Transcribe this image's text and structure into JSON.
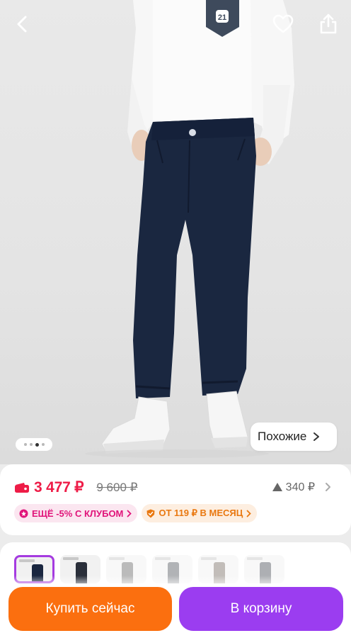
{
  "header": {
    "back_icon": "chevron-left-icon",
    "favorite_icon": "heart-icon",
    "share_icon": "share-icon"
  },
  "gallery": {
    "dots_count": 4,
    "active_dot": 2,
    "similar_label": "Похожие"
  },
  "price": {
    "current": "3 477 ₽",
    "old": "9 600 ₽",
    "score": "340 ₽",
    "accent_color": "#ee1c47"
  },
  "chips": {
    "club": "ЕЩЁ -5% С КЛУБОМ",
    "installment": "ОТ 119 ₽ В МЕСЯЦ"
  },
  "actions": {
    "buy_now": "Купить сейчас",
    "add_to_cart": "В корзину",
    "buy_color": "#fb6f0f",
    "cart_color": "#9b3df0"
  }
}
